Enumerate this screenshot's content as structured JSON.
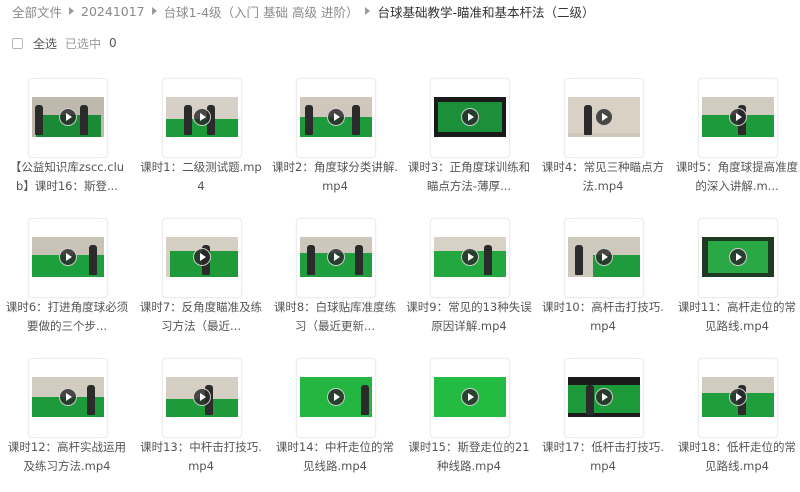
{
  "breadcrumb": [
    {
      "label": "全部文件"
    },
    {
      "label": "20241017"
    },
    {
      "label": "台球1-4级（入门 基础 高级 进阶）"
    },
    {
      "label": "台球基础教学-瞄准和基本杆法（二级）"
    }
  ],
  "selection": {
    "select_all_label": "全选",
    "selected_label": "已选中",
    "selected_count": "0"
  },
  "files": [
    {
      "name": "【公益知识库zscc.club】课时16：斯登..."
    },
    {
      "name": "课时1：二级测试题.mp4"
    },
    {
      "name": "课时2：角度球分类讲解.mp4"
    },
    {
      "name": "课时3：正角度球训练和瞄点方法-薄厚..."
    },
    {
      "name": "课时4：常见三种瞄点方法.mp4"
    },
    {
      "name": "课时5：角度球提高准度的深入讲解.m..."
    },
    {
      "name": "课时6：打进角度球必须要做的三个步..."
    },
    {
      "name": "课时7：反角度瞄准及练习方法（最近..."
    },
    {
      "name": "课时8：白球贴库准度练习（最近更新..."
    },
    {
      "name": "课时9：常见的13种失误原因详解.mp4"
    },
    {
      "name": "课时10：高杆击打技巧.mp4"
    },
    {
      "name": "课时11：高杆走位的常见路线.mp4"
    },
    {
      "name": "课时12：高杆实战运用及练习方法.mp4"
    },
    {
      "name": "课时13：中杆击打技巧.mp4"
    },
    {
      "name": "课时14：中杆走位的常见线路.mp4"
    },
    {
      "name": "课时15：斯登走位的21种线路.mp4"
    },
    {
      "name": "课时17：低杆击打技巧.mp4"
    },
    {
      "name": "课时18：低杆走位的常见路线.mp4"
    }
  ],
  "colors": {
    "felt": "#1f9a3a",
    "felt_bright": "#22c23c",
    "wall": "#d9d2c6",
    "text": "#555555"
  },
  "icons": {
    "play": "play-icon",
    "separator": "chevron-right-icon"
  }
}
